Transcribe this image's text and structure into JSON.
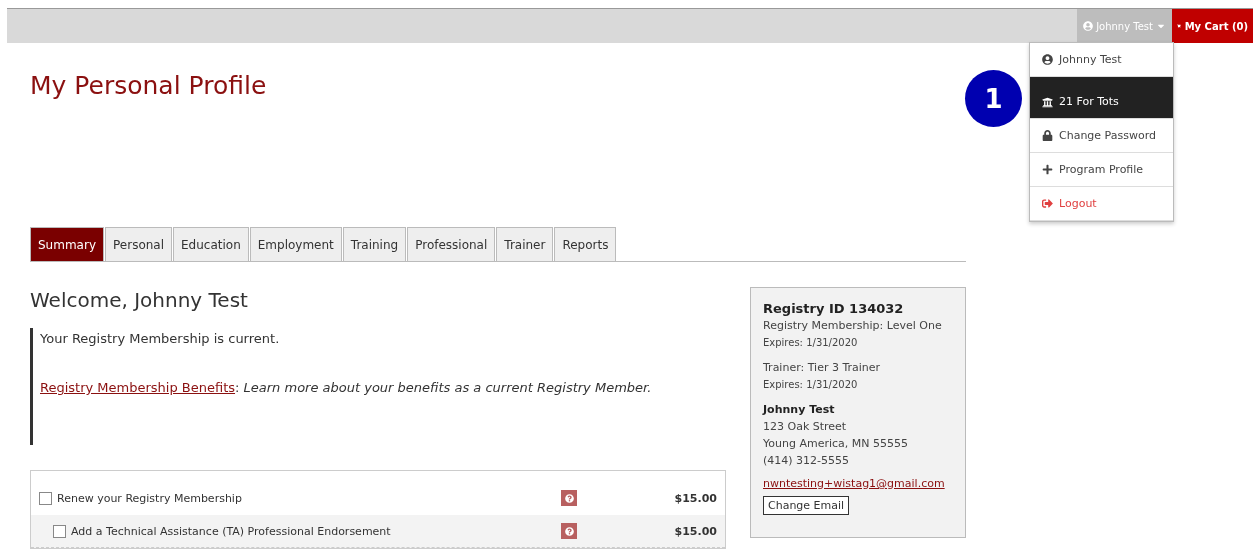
{
  "top_bar": {
    "user_button": "Johnny Test",
    "cart_button": "My Cart (0)"
  },
  "user_menu": {
    "expanded": true,
    "items": [
      {
        "label": "Johnny Test",
        "selected": false,
        "kind": "normal"
      },
      {
        "label": "21 For Tots",
        "selected": true,
        "kind": "normal"
      },
      {
        "label": "Change Password",
        "selected": false,
        "kind": "normal"
      },
      {
        "label": "Program Profile",
        "selected": false,
        "kind": "normal"
      },
      {
        "label": "Logout",
        "selected": false,
        "kind": "danger"
      }
    ]
  },
  "step_badge": "1",
  "page_title": "My Personal Profile",
  "tabs": [
    {
      "label": "Summary",
      "selected": true
    },
    {
      "label": "Personal",
      "selected": false
    },
    {
      "label": "Education",
      "selected": false
    },
    {
      "label": "Employment",
      "selected": false
    },
    {
      "label": "Training",
      "selected": false
    },
    {
      "label": "Professional",
      "selected": false
    },
    {
      "label": "Trainer",
      "selected": false
    },
    {
      "label": "Reports",
      "selected": false
    }
  ],
  "welcome": "Welcome, Johnny Test",
  "notice": {
    "status": "Your Registry Membership is current.",
    "link": "Registry Membership Benefits",
    "description": ": *Learn more about your benefits as a current Registry Member.*"
  },
  "purchases": [
    {
      "label": "Renew your Registry Membership",
      "price": "$15.00",
      "checked": false,
      "kind": "main"
    },
    {
      "label": "Add a Technical Assistance (TA) Professional Endorsement",
      "price": "$15.00",
      "checked": false,
      "kind": "addon"
    }
  ],
  "profile_card": {
    "registry_id": "Registry ID 134032",
    "membership": "Registry Membership: Level One",
    "membership_expires": "Expires: 1/31/2020",
    "trainer": "Trainer: Tier 3 Trainer",
    "trainer_expires": "Expires: 1/31/2020",
    "name": "Johnny Test",
    "address": [
      "123 Oak Street",
      "Young America, MN 55555",
      "(414) 312-5555"
    ],
    "email": "nwntesting+wistag1@gmail.com",
    "change_email_button": "Change Email"
  }
}
